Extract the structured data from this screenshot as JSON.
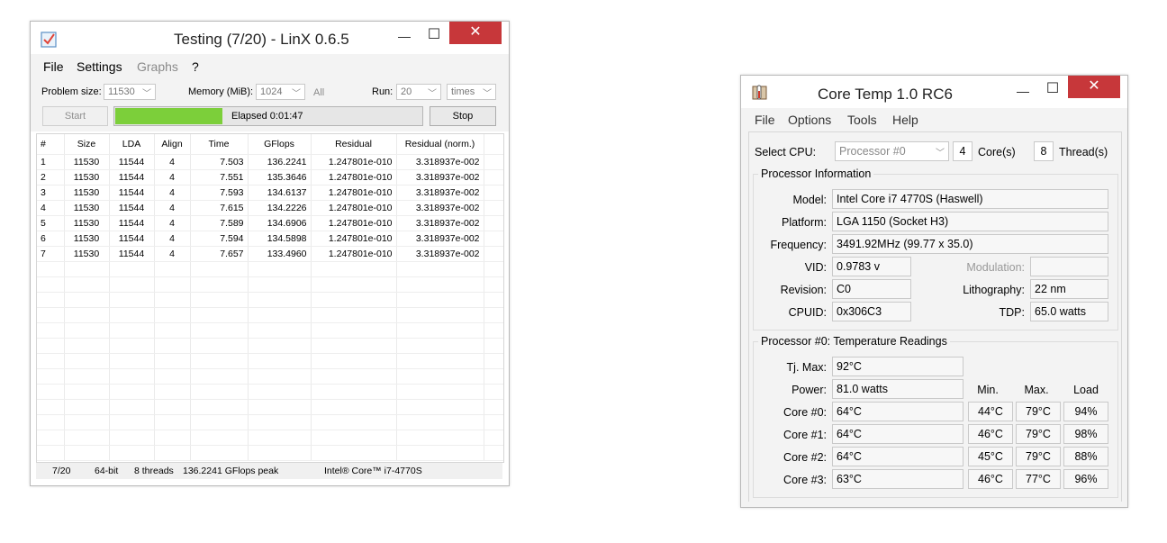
{
  "linx": {
    "title": "Testing (7/20) - LinX 0.6.5",
    "minimize": "—",
    "maximize": "☐",
    "close": "✕",
    "menu": {
      "file": "File",
      "settings": "Settings",
      "graphs": "Graphs",
      "help": "?"
    },
    "options": {
      "problem_size_label": "Problem size:",
      "problem_size_value": "11530",
      "memory_label": "Memory (MiB):",
      "memory_value": "1024",
      "all_label": "All",
      "run_label": "Run:",
      "run_value": "20",
      "times_value": "times"
    },
    "start_label": "Start",
    "stop_label": "Stop",
    "elapsed": "Elapsed 0:01:47",
    "progress": 0.35,
    "columns": [
      "#",
      "Size",
      "LDA",
      "Align",
      "Time",
      "GFlops",
      "Residual",
      "Residual (norm.)"
    ],
    "rows": [
      [
        "1",
        "11530",
        "11544",
        "4",
        "7.503",
        "136.2241",
        "1.247801e-010",
        "3.318937e-002"
      ],
      [
        "2",
        "11530",
        "11544",
        "4",
        "7.551",
        "135.3646",
        "1.247801e-010",
        "3.318937e-002"
      ],
      [
        "3",
        "11530",
        "11544",
        "4",
        "7.593",
        "134.6137",
        "1.247801e-010",
        "3.318937e-002"
      ],
      [
        "4",
        "11530",
        "11544",
        "4",
        "7.615",
        "134.2226",
        "1.247801e-010",
        "3.318937e-002"
      ],
      [
        "5",
        "11530",
        "11544",
        "4",
        "7.589",
        "134.6906",
        "1.247801e-010",
        "3.318937e-002"
      ],
      [
        "6",
        "11530",
        "11544",
        "4",
        "7.594",
        "134.5898",
        "1.247801e-010",
        "3.318937e-002"
      ],
      [
        "7",
        "11530",
        "11544",
        "4",
        "7.657",
        "133.4960",
        "1.247801e-010",
        "3.318937e-002"
      ]
    ],
    "status": {
      "progress": "7/20",
      "bits": "64-bit",
      "threads": "8 threads",
      "peak": "136.2241 GFlops peak",
      "cpu": "Intel® Core™ i7-4770S"
    },
    "colors": {
      "progress_fill": "#7ccf3a",
      "close": "#c7373a"
    }
  },
  "coretemp": {
    "title": "Core Temp 1.0 RC6",
    "minimize": "—",
    "maximize": "☐",
    "close": "✕",
    "menu": {
      "file": "File",
      "options": "Options",
      "tools": "Tools",
      "help": "Help"
    },
    "select_cpu_label": "Select CPU:",
    "select_cpu_value": "Processor #0",
    "cores_value": "4",
    "cores_label": "Core(s)",
    "threads_value": "8",
    "threads_label": "Thread(s)",
    "proc_info_title": "Processor Information",
    "model_label": "Model:",
    "model_value": "Intel Core i7 4770S (Haswell)",
    "platform_label": "Platform:",
    "platform_value": "LGA 1150 (Socket H3)",
    "frequency_label": "Frequency:",
    "frequency_value": "3491.92MHz (99.77 x 35.0)",
    "vid_label": "VID:",
    "vid_value": "0.9783 v",
    "modulation_label": "Modulation:",
    "modulation_value": "",
    "revision_label": "Revision:",
    "revision_value": "C0",
    "lithography_label": "Lithography:",
    "lithography_value": "22 nm",
    "cpuid_label": "CPUID:",
    "cpuid_value": "0x306C3",
    "tdp_label": "TDP:",
    "tdp_value": "65.0 watts",
    "temp_title": "Processor #0: Temperature Readings",
    "tjmax_label": "Tj. Max:",
    "tjmax_value": "92°C",
    "power_label": "Power:",
    "power_value": "81.0 watts",
    "min_header": "Min.",
    "max_header": "Max.",
    "load_header": "Load",
    "cores": [
      {
        "label": "Core #0:",
        "temp": "64°C",
        "min": "44°C",
        "max": "79°C",
        "load": "94%"
      },
      {
        "label": "Core #1:",
        "temp": "64°C",
        "min": "46°C",
        "max": "79°C",
        "load": "98%"
      },
      {
        "label": "Core #2:",
        "temp": "64°C",
        "min": "45°C",
        "max": "79°C",
        "load": "88%"
      },
      {
        "label": "Core #3:",
        "temp": "63°C",
        "min": "46°C",
        "max": "77°C",
        "load": "96%"
      }
    ]
  }
}
